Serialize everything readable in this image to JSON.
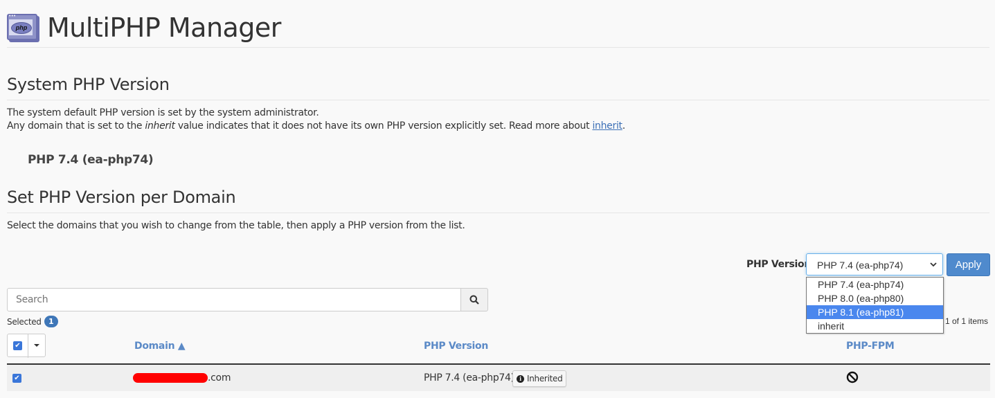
{
  "header": {
    "title": "MultiPHP Manager",
    "icon": "php-window-icon",
    "icon_text": "php"
  },
  "system_section": {
    "heading": "System PHP Version",
    "line1": "The system default PHP version is set by the system administrator.",
    "line2_pre": "Any domain that is set to the ",
    "line2_em": "inherit",
    "line2_mid": " value indicates that it does not have its own PHP version explicitly set. Read more about ",
    "line2_link": "inherit",
    "line2_post": ".",
    "current_version": "PHP 7.4 (ea-php74)"
  },
  "domain_section": {
    "heading": "Set PHP Version per Domain",
    "instructions": "Select the domains that you wish to change from the table, then apply a PHP version from the list."
  },
  "php_selector": {
    "label": "PHP Version",
    "selected_value": "PHP 7.4 (ea-php74)",
    "options": [
      {
        "label": "PHP 7.4 (ea-php74)",
        "highlighted": false
      },
      {
        "label": "PHP 8.0 (ea-php80)",
        "highlighted": false
      },
      {
        "label": "PHP 8.1 (ea-php81)",
        "highlighted": true
      },
      {
        "label": "inherit",
        "highlighted": false
      }
    ],
    "apply_label": "Apply"
  },
  "search": {
    "placeholder": "Search",
    "value": "",
    "button_icon": "search-icon"
  },
  "selection": {
    "label": "Selected",
    "count": "1"
  },
  "pagination": {
    "items_text": "1 of 1 items"
  },
  "table": {
    "columns": [
      {
        "label": "Domain ▲",
        "sorted": "ascending"
      },
      {
        "label": "PHP Version"
      },
      {
        "label": "PHP-FPM"
      }
    ],
    "rows": [
      {
        "checked": true,
        "domain_visible_suffix": ".com",
        "domain_redacted": true,
        "php_version": "PHP 7.4 (ea-php74)",
        "php_badge": "Inherited",
        "php_fpm": "disabled",
        "php_fpm_icon": "ban-icon"
      }
    ]
  },
  "colors": {
    "accent": "#4f8acd",
    "header_link": "#5b8ac7",
    "highlight_option": "#4a87ee",
    "badge": "#3f77b8",
    "redaction": "#ff0000"
  }
}
